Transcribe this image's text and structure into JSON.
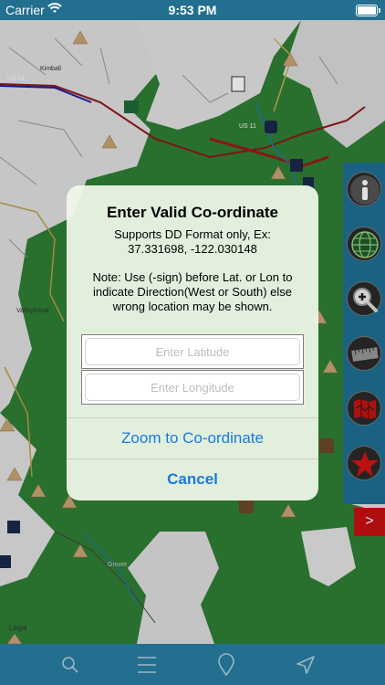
{
  "status_bar": {
    "carrier": "Carrier",
    "time": "9:53 PM"
  },
  "map": {
    "road_labels": [
      "Kimball",
      "US 11",
      "US 11",
      "Valleybrook",
      "Grover",
      "Legal"
    ]
  },
  "side_toolbar": {
    "buttons": [
      {
        "icon": "info-icon"
      },
      {
        "icon": "globe-icon"
      },
      {
        "icon": "zoom-in-icon"
      },
      {
        "icon": "ruler-icon"
      },
      {
        "icon": "map-layers-icon"
      },
      {
        "icon": "star-icon"
      }
    ],
    "expand_label": ">"
  },
  "dialog": {
    "title": "Enter Valid Co-ordinate",
    "message_line1": "Supports DD Format only, Ex:",
    "message_line2": "37.331698, -122.030148",
    "note": "Note: Use (-sign) before Lat. or Lon to indicate Direction(West or South) else wrong location may be shown.",
    "latitude_placeholder": "Enter Latitude",
    "longitude_placeholder": "Enter Longitude",
    "zoom_label": "Zoom to Co-ordinate",
    "cancel_label": "Cancel"
  },
  "tab_bar": {
    "items": [
      "search-icon",
      "menu-icon",
      "location-pin-icon",
      "navigation-arrow-icon"
    ]
  },
  "colors": {
    "bar_blue": "#236f8f",
    "action_blue": "#1a7ae0",
    "map_green": "#2e7d32",
    "map_land": "#e3e3e3",
    "alert_red": "#c81010"
  }
}
